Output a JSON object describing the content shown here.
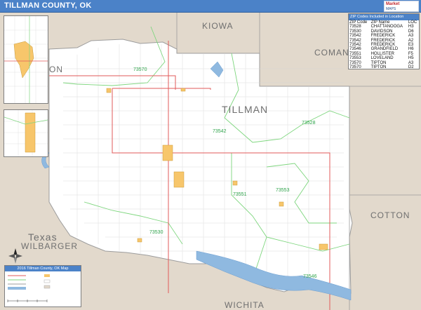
{
  "header": {
    "title": "TILLMAN COUNTY, OK"
  },
  "logo": {
    "brand_top": "Market",
    "brand_bottom": "MAPS"
  },
  "colors": {
    "title_bar": "#4b82c8",
    "county_fill": "#ffffff",
    "outside_fill": "#e2d9cc",
    "zip_boundary": "#7ed67e",
    "highway": "#e25a5a",
    "water": "#8fb9e0",
    "urban": "#f7c66b"
  },
  "regions": {
    "kiowa": "KIOWA",
    "comanche": "COMAN",
    "tillman": "TILLMAN",
    "cotton": "COTTON",
    "wichita": "WICHITA",
    "texas": "Texas",
    "wilbarger": "WILBARGER",
    "jackson_partial": "ON"
  },
  "zips": {
    "z73570_north": "73570",
    "z73542": "73542",
    "z73528": "73528",
    "z73551": "73551",
    "z73553": "73553",
    "z73530": "73530",
    "z73546": "73546"
  },
  "zip_table": {
    "title": "ZIP Codes Included in Location",
    "headers": [
      "ZIP Code",
      "ZIP Name",
      "LOC"
    ],
    "rows": [
      [
        "73528",
        "CHATTANOOGA",
        "H3"
      ],
      [
        "73530",
        "DAVIDSON",
        "D6"
      ],
      [
        "73542",
        "FREDERICK",
        "A3"
      ],
      [
        "73542",
        "FREDERICK",
        "A2"
      ],
      [
        "73542",
        "FREDERICK",
        "E3"
      ],
      [
        "73546",
        "GRANDFIELD",
        "H6"
      ],
      [
        "73551",
        "HOLLISTER",
        "F5"
      ],
      [
        "73553",
        "LOVELAND",
        "H5"
      ],
      [
        "73570",
        "TIPTON",
        "A3"
      ],
      [
        "73570",
        "TIPTON",
        "D2"
      ]
    ]
  },
  "map_legend": {
    "title": "2016 Tillman County, OK Map"
  }
}
